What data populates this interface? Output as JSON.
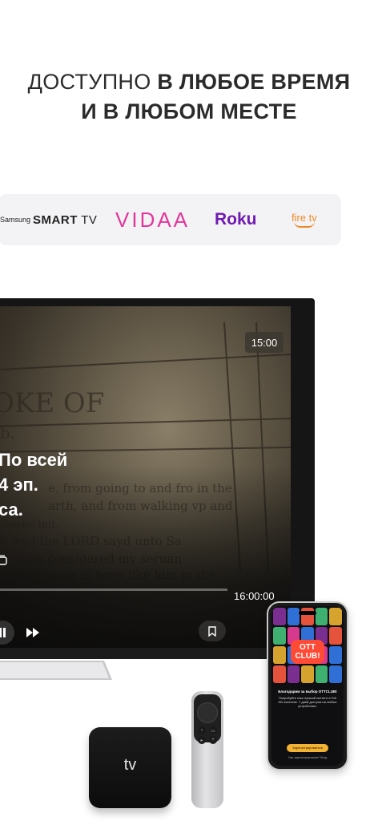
{
  "headline": {
    "line1_light": "ДОСТУПНО ",
    "line1_bold": "В ЛЮБОЕ ВРЕМЯ",
    "line2": "И В ЛЮБОМ МЕСТЕ"
  },
  "platforms": {
    "samsung_small": "Samsung",
    "samsung_smart": "SMART",
    "samsung_tv": " TV",
    "vidaa": "VIDAA",
    "roku": "Roku",
    "firetv": "fire tv"
  },
  "player": {
    "current_time": "15:00",
    "title_lines": [
      "По всей",
      "4 эп.",
      "са."
    ],
    "end_time": "16:00:00",
    "icons": {
      "pause": "pause-icon",
      "fast_forward": "fast-forward-icon",
      "bookmark": "bookmark-icon",
      "episodes": "episodes-icon"
    }
  },
  "devices": {
    "apple_tv_label": "tv",
    "phone": {
      "badge_line1": "OTT",
      "badge_line2": "CLUB!",
      "welcome": "Благодарим за выбор OTTCLUB!",
      "body": "Попробуйте наш лучший контент в Full HD качестве. 7 дней доступа на любых устройствах.",
      "button": "Зарегистрироваться",
      "login": "Уже зарегистрированы? Вход"
    }
  },
  "colors": {
    "vidaa": "#e2389b",
    "roku": "#6f1ab1",
    "firetv": "#f08a24",
    "phone_button": "#f4b232",
    "ott_badge": "#ff4a36"
  }
}
